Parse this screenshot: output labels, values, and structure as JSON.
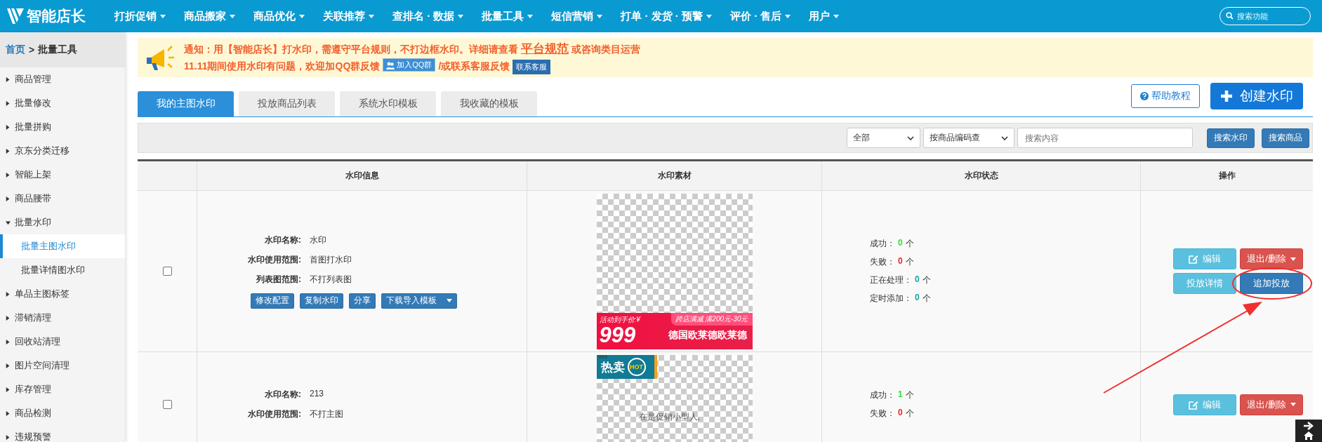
{
  "topbar": {
    "logo": "智能店长",
    "menu": [
      {
        "label": "打折促销"
      },
      {
        "label": "商品搬家"
      },
      {
        "label": "商品优化"
      },
      {
        "label": "关联推荐"
      },
      {
        "label": "查排名 · 数据"
      },
      {
        "label": "批量工具"
      },
      {
        "label": "短信营销"
      },
      {
        "label": "打单 · 发货 · 预警"
      },
      {
        "label": "评价 · 售后"
      },
      {
        "label": "用户"
      }
    ],
    "search": {
      "placeholder": "搜索功能"
    }
  },
  "breadcrumb": {
    "home": "首页",
    "separator": ">",
    "current": "批量工具"
  },
  "sidebar": {
    "items": [
      {
        "label": "商品管理",
        "expanded": false
      },
      {
        "label": "批量修改",
        "expanded": false
      },
      {
        "label": "批量拼购",
        "expanded": false
      },
      {
        "label": "京东分类迁移",
        "expanded": false
      },
      {
        "label": "智能上架",
        "expanded": false
      },
      {
        "label": "商品腰带",
        "expanded": false
      },
      {
        "label": "批量水印",
        "expanded": true,
        "children": [
          {
            "label": "批量主图水印",
            "selected": true
          },
          {
            "label": "批量详情图水印",
            "selected": false
          }
        ]
      },
      {
        "label": "单品主图标签",
        "expanded": false
      },
      {
        "label": "滞销清理",
        "expanded": false
      },
      {
        "label": "回收站清理",
        "expanded": false
      },
      {
        "label": "图片空间清理",
        "expanded": false
      },
      {
        "label": "库存管理",
        "expanded": false
      },
      {
        "label": "商品检测",
        "expanded": false
      },
      {
        "label": "违规预警",
        "expanded": false
      }
    ]
  },
  "notice": {
    "line1": "通知：用【智能店长】打水印，需遵守平台规则，不打边框水印。详细请查看",
    "link": "平台规范",
    "line1_tail": "或咨询类目运营",
    "line2": "11.11期间使用水印有问题，欢迎加QQ群反馈",
    "qq_button": "加入QQ群",
    "line2_tail": "/或联系客服反馈",
    "service_button": "联系客服"
  },
  "tabs": [
    {
      "label": "我的主图水印",
      "selected": true
    },
    {
      "label": "投放商品列表",
      "selected": false
    },
    {
      "label": "系统水印模板",
      "selected": false
    },
    {
      "label": "我收藏的模板",
      "selected": false
    }
  ],
  "help_button": "帮助教程",
  "create_button": "创建水印",
  "filters": {
    "scope": "全部",
    "search_by": "按商品编码查",
    "search": {
      "placeholder": "搜索内容"
    },
    "buttons": [
      "搜索水印",
      "搜索商品"
    ]
  },
  "table": {
    "columns": [
      "水印信息",
      "水印素材",
      "水印状态",
      "操作"
    ],
    "rows": [
      {
        "checked": false,
        "info": [
          {
            "label": "水印名称:",
            "value": "水印"
          },
          {
            "label": "水印使用范围:",
            "value": "首图打水印"
          },
          {
            "label": "列表图范围:",
            "value": "不打列表图"
          }
        ],
        "info_buttons": [
          {
            "label": "修改配置",
            "kind": "plain"
          },
          {
            "label": "复制水印",
            "kind": "plain"
          },
          {
            "label": "分享",
            "kind": "plain"
          },
          {
            "label": "下载导入模板",
            "kind": "dropdown"
          }
        ],
        "material": {
          "kind": "banner",
          "price_label": "活动到手价:¥",
          "price": "999",
          "promo": "跨店满减 满200元-30元",
          "title": "德国欧莱德欧莱德"
        },
        "status": [
          {
            "label": "成功：",
            "count": "0",
            "unit": "个",
            "color": "#33dd33"
          },
          {
            "label": "失败：",
            "count": "0",
            "unit": "个",
            "color": "#ee2222"
          },
          {
            "label": "正在处理：",
            "count": "0",
            "unit": "个",
            "color": "#1aa3a3"
          },
          {
            "label": "定时添加：",
            "count": "0",
            "unit": "个",
            "color": "#1aa3a3"
          }
        ],
        "actions": [
          {
            "label": "编辑",
            "kind": "edit",
            "highlighted": false
          },
          {
            "label": "退出/删除",
            "kind": "danger",
            "highlighted": false
          },
          {
            "label": "投放详情",
            "kind": "info",
            "highlighted": false
          },
          {
            "label": "追加投放",
            "kind": "primary",
            "highlighted": true
          }
        ]
      },
      {
        "checked": false,
        "info": [
          {
            "label": "水印名称:",
            "value": "213"
          },
          {
            "label": "水印使用范围:",
            "value": "不打主图"
          }
        ],
        "material": {
          "kind": "hot",
          "corner": "999",
          "badge": "热卖",
          "hot": "HOT",
          "caption": "在是促销小型人,"
        },
        "status": [
          {
            "label": "成功：",
            "count": "1",
            "unit": "个",
            "color": "#33dd33"
          },
          {
            "label": "失败：",
            "count": "0",
            "unit": "个",
            "color": "#ee2222"
          }
        ],
        "actions": [
          {
            "label": "编辑",
            "kind": "edit",
            "highlighted": false
          },
          {
            "label": "退出/删除",
            "kind": "danger",
            "highlighted": false
          }
        ]
      }
    ]
  }
}
